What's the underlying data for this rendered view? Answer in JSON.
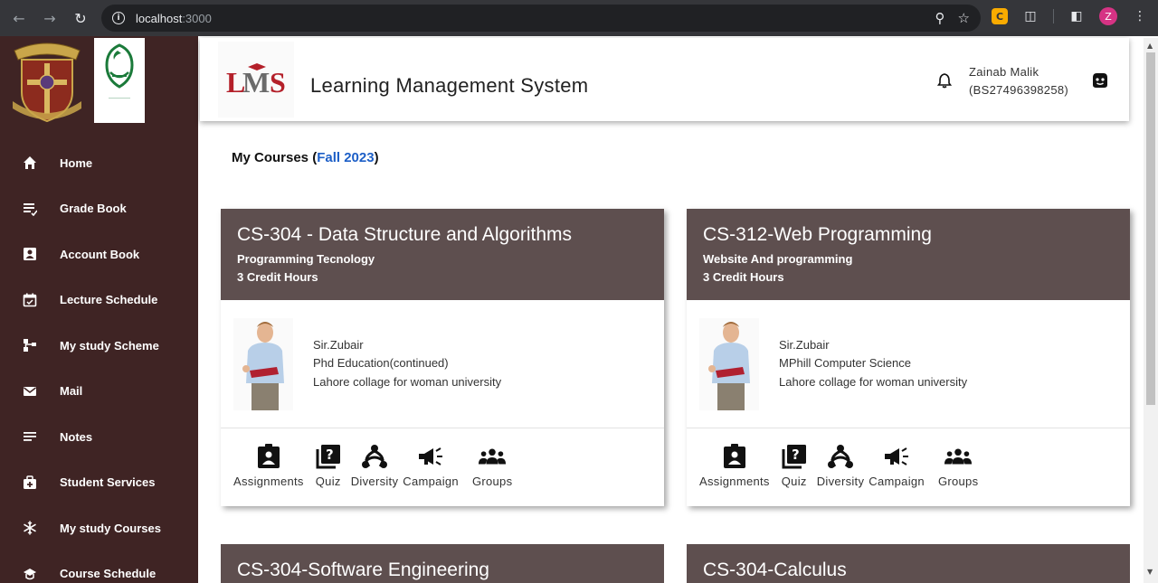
{
  "browser": {
    "url_host": "localhost",
    "url_port": ":3000",
    "profile_initial": "Z"
  },
  "sidebar": {
    "items": [
      {
        "label": "Home",
        "icon": "home-icon"
      },
      {
        "label": "Grade Book",
        "icon": "grade-book-icon"
      },
      {
        "label": "Account Book",
        "icon": "account-book-icon"
      },
      {
        "label": "Lecture Schedule",
        "icon": "calendar-icon"
      },
      {
        "label": "My study Scheme",
        "icon": "scheme-icon"
      },
      {
        "label": "Mail",
        "icon": "mail-icon"
      },
      {
        "label": "Notes",
        "icon": "notes-icon"
      },
      {
        "label": "Student Services",
        "icon": "services-icon"
      },
      {
        "label": "My study Courses",
        "icon": "courses-icon"
      },
      {
        "label": "Course Schedule",
        "icon": "course-schedule-icon"
      }
    ]
  },
  "header": {
    "logo_text": "LMS",
    "title": "Learning Management System",
    "user_name": "Zainab Malik",
    "user_id": "(BS27496398258)"
  },
  "main": {
    "section_label": "My Courses (",
    "term": "Fall 2023",
    "section_close": ")",
    "courses": [
      {
        "title": "CS-304 - Data Structure and Algorithms",
        "subtitle": "Programming Tecnology",
        "credits": "3 Credit Hours",
        "teacher": "Sir.Zubair",
        "qualification": "Phd Education(continued)",
        "institution": "Lahore collage for woman university"
      },
      {
        "title": "CS-312-Web Programming",
        "subtitle": "Website And programming",
        "credits": "3 Credit Hours",
        "teacher": "Sir.Zubair",
        "qualification": "MPhill Computer Science",
        "institution": "Lahore collage for woman university"
      },
      {
        "title": "CS-304-Software Engineering"
      },
      {
        "title": "CS-304-Calculus"
      }
    ],
    "actions": [
      "Assignments",
      "Quiz",
      "Diversity",
      "Campaign",
      "Groups"
    ]
  },
  "colors": {
    "sidebar_bg": "#3f2424",
    "card_header": "#5e4f4f",
    "term_link": "#1d5fc7"
  }
}
